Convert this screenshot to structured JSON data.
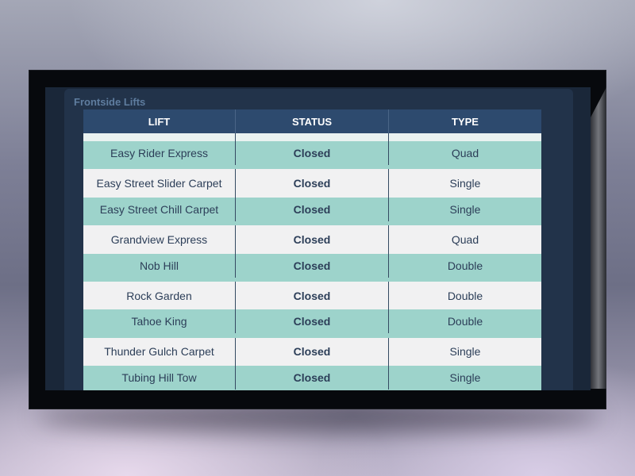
{
  "panel": {
    "title": "Frontside Lifts"
  },
  "table": {
    "headers": [
      "LIFT",
      "STATUS",
      "TYPE"
    ],
    "rows": [
      {
        "lift": "Easy Rider Express",
        "status": "Closed",
        "type": "Quad"
      },
      {
        "lift": "Easy Street Slider Carpet",
        "status": "Closed",
        "type": "Single"
      },
      {
        "lift": "Easy Street Chill Carpet",
        "status": "Closed",
        "type": "Single"
      },
      {
        "lift": "Grandview Express",
        "status": "Closed",
        "type": "Quad"
      },
      {
        "lift": "Nob Hill",
        "status": "Closed",
        "type": "Double"
      },
      {
        "lift": "Rock Garden",
        "status": "Closed",
        "type": "Double"
      },
      {
        "lift": "Tahoe King",
        "status": "Closed",
        "type": "Double"
      },
      {
        "lift": "Thunder Gulch Carpet",
        "status": "Closed",
        "type": "Single"
      },
      {
        "lift": "Tubing Hill Tow",
        "status": "Closed",
        "type": "Single"
      }
    ]
  },
  "colors": {
    "header_bg": "#2d4a6e",
    "row_teal": "#9dd3cb",
    "row_light": "#f1f1f2",
    "text": "#2c3e58",
    "panel_title": "#5f7d9f"
  }
}
